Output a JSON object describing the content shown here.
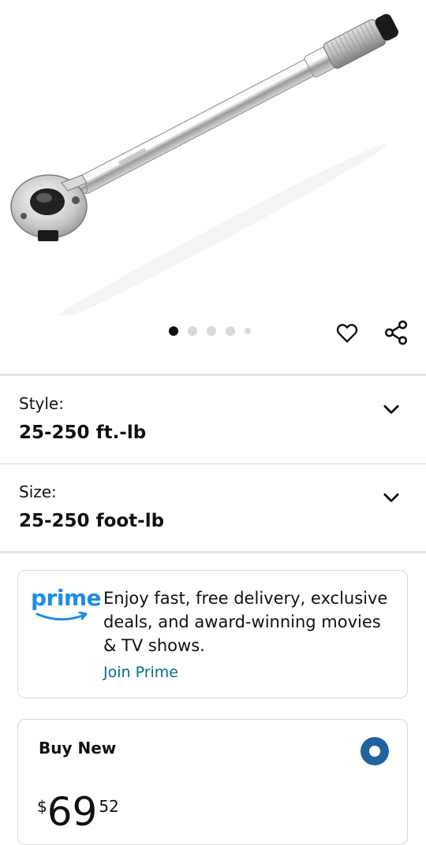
{
  "product": {
    "image_alt": "Torque wrench product image",
    "image_count": 5,
    "active_image_index": 0
  },
  "icons": {
    "favorite": "heart-icon",
    "share": "share-icon",
    "chevron": "chevron-down-icon",
    "prime_logo": "prime-logo"
  },
  "variations": [
    {
      "label": "Style:",
      "value": "25-250 ft.-lb"
    },
    {
      "label": "Size:",
      "value": "25-250 foot-lb"
    }
  ],
  "prime": {
    "logo_text": "prime",
    "message": "Enjoy fast, free delivery, exclusive deals, and award-winning movies & TV shows.",
    "link": "Join Prime"
  },
  "buy_box": {
    "title": "Buy New",
    "price_symbol": "$",
    "price_whole": "69",
    "price_fraction": "52",
    "selected": true
  },
  "colors": {
    "prime_blue": "#1f8ce6",
    "link_teal": "#007185",
    "radio_blue": "#2162a1",
    "text": "#0f1111"
  }
}
